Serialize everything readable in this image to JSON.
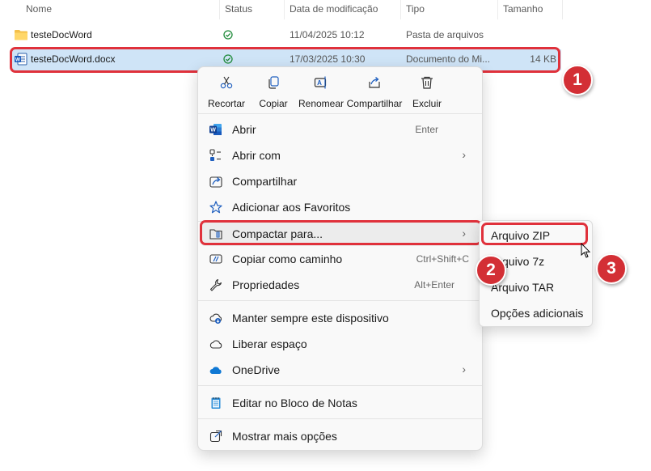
{
  "columns": {
    "name": "Nome",
    "status": "Status",
    "date": "Data de modificação",
    "type": "Tipo",
    "size": "Tamanho"
  },
  "files": [
    {
      "name": "testeDocWord",
      "icon": "folder-icon",
      "date": "11/04/2025 10:12",
      "type": "Pasta de arquivos",
      "size": ""
    },
    {
      "name": "testeDocWord.docx",
      "icon": "word-doc-icon",
      "date": "17/03/2025 10:30",
      "type": "Documento do Mi...",
      "size": "14 KB"
    }
  ],
  "quick_actions": [
    {
      "label": "Recortar",
      "icon": "cut-icon"
    },
    {
      "label": "Copiar",
      "icon": "copy-icon"
    },
    {
      "label": "Renomear",
      "icon": "rename-icon"
    },
    {
      "label": "Compartilhar",
      "icon": "share-icon"
    },
    {
      "label": "Excluir",
      "icon": "trash-icon"
    }
  ],
  "menu": {
    "open": {
      "label": "Abrir",
      "shortcut": "Enter"
    },
    "open_with": {
      "label": "Abrir com"
    },
    "share": {
      "label": "Compartilhar"
    },
    "favorites": {
      "label": "Adicionar aos Favoritos"
    },
    "compress": {
      "label": "Compactar para..."
    },
    "copy_path": {
      "label": "Copiar como caminho",
      "shortcut": "Ctrl+Shift+C"
    },
    "properties": {
      "label": "Propriedades",
      "shortcut": "Alt+Enter"
    },
    "keep_device": {
      "label": "Manter sempre este dispositivo"
    },
    "free_space": {
      "label": "Liberar espaço"
    },
    "onedrive": {
      "label": "OneDrive"
    },
    "notepad": {
      "label": "Editar no Bloco de Notas"
    },
    "more_options": {
      "label": "Mostrar mais opções"
    }
  },
  "submenu": [
    "Arquivo ZIP",
    "Arquivo 7z",
    "Arquivo TAR",
    "Opções adicionais"
  ],
  "badges": [
    "1",
    "2",
    "3"
  ],
  "colors": {
    "highlight": "#e0313b",
    "badge": "#d32f35",
    "selected_row": "#cfe4f7",
    "accent": "#0067c0"
  }
}
